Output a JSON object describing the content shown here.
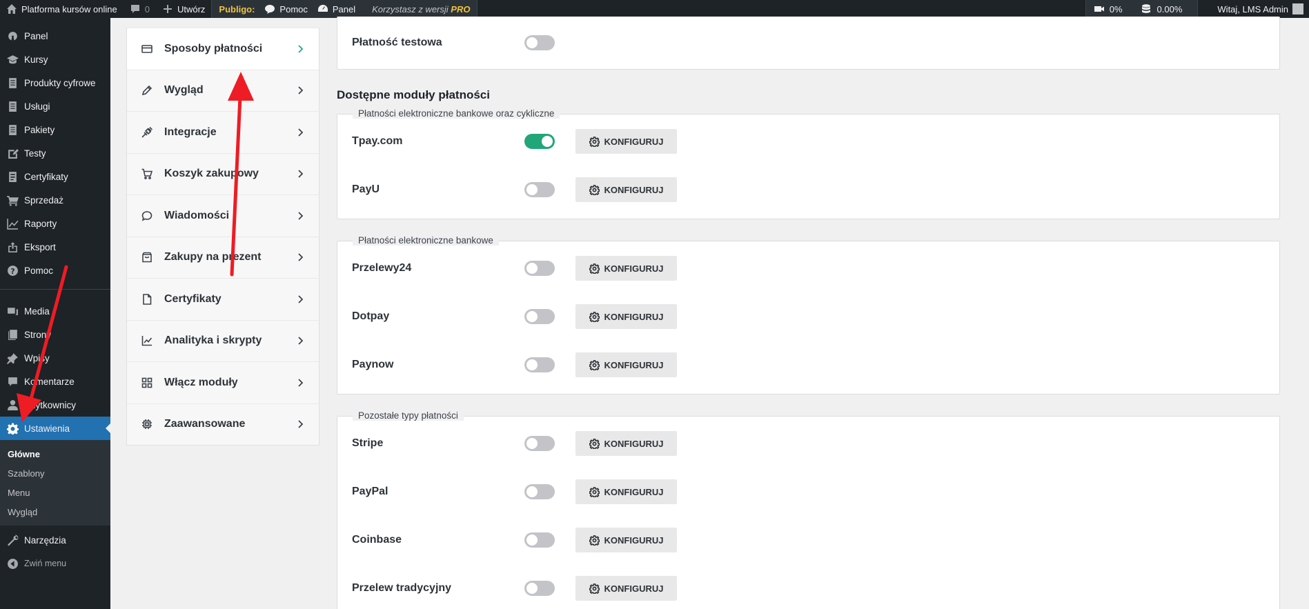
{
  "adminbar": {
    "site_name": "Platforma kursów online",
    "comments_count": "0",
    "new_label": "Utwórz",
    "publigo_brand": "Publigo:",
    "help_label": "Pomoc",
    "panel_label": "Panel",
    "pro_text": "Korzystasz z wersji",
    "pro_badge": "PRO",
    "video_stat": "0%",
    "db_stat": "0.00%",
    "greeting": "Witaj, LMS Admin"
  },
  "sidebar": {
    "items": [
      {
        "label": "Panel",
        "icon": "gauge-icon"
      },
      {
        "label": "Kursy",
        "icon": "graduation-cap-icon"
      },
      {
        "label": "Produkty cyfrowe",
        "icon": "document-icon"
      },
      {
        "label": "Usługi",
        "icon": "document-icon"
      },
      {
        "label": "Pakiety",
        "icon": "document-icon"
      },
      {
        "label": "Testy",
        "icon": "edit-icon"
      },
      {
        "label": "Certyfikaty",
        "icon": "certificate-icon"
      },
      {
        "label": "Sprzedaż",
        "icon": "cart-icon"
      },
      {
        "label": "Raporty",
        "icon": "chart-icon"
      },
      {
        "label": "Eksport",
        "icon": "export-icon"
      },
      {
        "label": "Pomoc",
        "icon": "help-icon"
      }
    ],
    "items2": [
      {
        "label": "Media",
        "icon": "media-icon"
      },
      {
        "label": "Strony",
        "icon": "pages-icon"
      },
      {
        "label": "Wpisy",
        "icon": "pin-icon"
      },
      {
        "label": "Komentarze",
        "icon": "comment-icon"
      },
      {
        "label": "Użytkownicy",
        "icon": "user-icon"
      }
    ],
    "active": {
      "label": "Ustawienia",
      "icon": "gear-icon"
    },
    "submenu": [
      "Główne",
      "Szablony",
      "Menu",
      "Wygląd"
    ],
    "tools": {
      "label": "Narzędzia",
      "icon": "wrench-icon"
    },
    "collapse": {
      "label": "Zwiń menu",
      "icon": "collapse-icon"
    }
  },
  "settings_nav": [
    {
      "label": "Sposoby płatności",
      "icon": "card-icon",
      "active": true
    },
    {
      "label": "Wygląd",
      "icon": "pencil-icon"
    },
    {
      "label": "Integracje",
      "icon": "plug-icon"
    },
    {
      "label": "Koszyk zakupowy",
      "icon": "cart-icon"
    },
    {
      "label": "Wiadomości",
      "icon": "message-icon"
    },
    {
      "label": "Zakupy na prezent",
      "icon": "gift-icon"
    },
    {
      "label": "Certyfikaty",
      "icon": "file-icon"
    },
    {
      "label": "Analityka i skrypty",
      "icon": "chart-icon"
    },
    {
      "label": "Włącz moduły",
      "icon": "grid-icon"
    },
    {
      "label": "Zaawansowane",
      "icon": "chip-icon"
    }
  ],
  "main": {
    "test_payment": {
      "name": "Płatność testowa",
      "enabled": false
    },
    "section_title": "Dostępne moduły płatności",
    "configure_label": "KONFIGURUJ",
    "groups": [
      {
        "legend": "Płatności elektroniczne bankowe oraz cykliczne",
        "modules": [
          {
            "name": "Tpay.com",
            "enabled": true
          },
          {
            "name": "PayU",
            "enabled": false
          }
        ]
      },
      {
        "legend": "Płatności elektroniczne bankowe",
        "modules": [
          {
            "name": "Przelewy24",
            "enabled": false
          },
          {
            "name": "Dotpay",
            "enabled": false
          },
          {
            "name": "Paynow",
            "enabled": false
          }
        ]
      },
      {
        "legend": "Pozostałe typy płatności",
        "modules": [
          {
            "name": "Stripe",
            "enabled": false
          },
          {
            "name": "PayPal",
            "enabled": false
          },
          {
            "name": "Coinbase",
            "enabled": false
          },
          {
            "name": "Przelew tradycyjny",
            "enabled": false
          }
        ]
      }
    ]
  },
  "colors": {
    "accent": "#2271b1",
    "toggle_on": "#21a67a",
    "annotation": "#ee1c24"
  }
}
